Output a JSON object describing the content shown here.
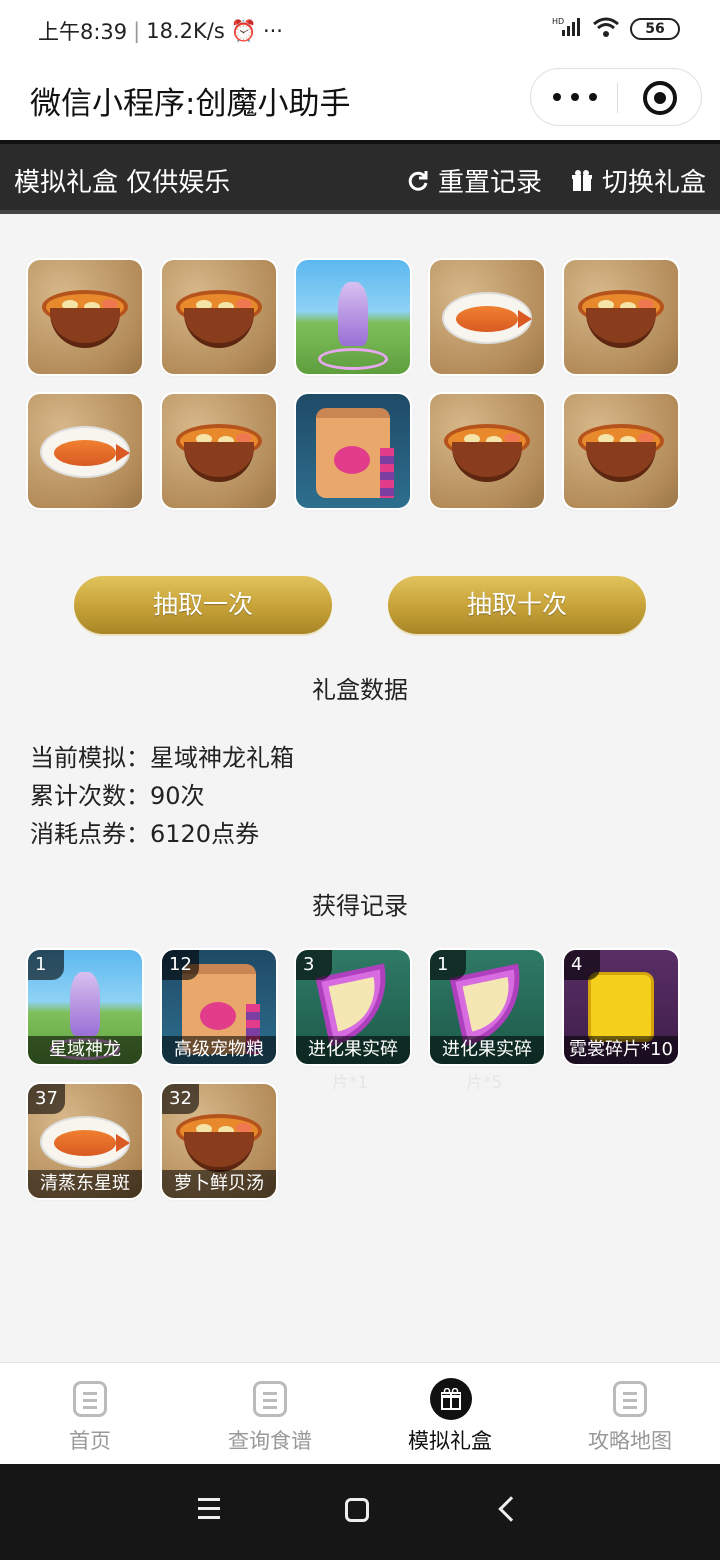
{
  "status": {
    "time": "上午8:39",
    "speed": "18.2K/s",
    "battery": "56",
    "network": "HD"
  },
  "titlebar": {
    "title": "微信小程序:创魔小助手"
  },
  "header": {
    "left": "模拟礼盒 仅供娱乐",
    "reset": "重置记录",
    "switch": "切换礼盒"
  },
  "grid": [
    {
      "type": "soup"
    },
    {
      "type": "soup"
    },
    {
      "type": "dragon"
    },
    {
      "type": "fish"
    },
    {
      "type": "soup"
    },
    {
      "type": "fish"
    },
    {
      "type": "soup"
    },
    {
      "type": "bag"
    },
    {
      "type": "soup"
    },
    {
      "type": "soup"
    }
  ],
  "buttons": {
    "draw_one": "抽取一次",
    "draw_ten": "抽取十次"
  },
  "stats": {
    "title": "礼盒数据",
    "current_label": "当前模拟：",
    "current_value": "星域神龙礼箱",
    "count_label": "累计次数：",
    "count_value": "90次",
    "cost_label": "消耗点券：",
    "cost_value": "6120点券"
  },
  "records": {
    "title": "获得记录",
    "items": [
      {
        "count": "1",
        "name": "星域神龙",
        "type": "dragon"
      },
      {
        "count": "12",
        "name": "高级宠物粮",
        "type": "bag"
      },
      {
        "count": "3",
        "name": "进化果实碎",
        "overflow": "片*1",
        "type": "fruit"
      },
      {
        "count": "1",
        "name": "进化果实碎",
        "overflow": "片*5",
        "type": "fruit"
      },
      {
        "count": "4",
        "name": "霓裳碎片*10",
        "type": "shirt"
      },
      {
        "count": "37",
        "name": "清蒸东星斑",
        "type": "fish"
      },
      {
        "count": "32",
        "name": "萝卜鲜贝汤",
        "type": "soup"
      }
    ]
  },
  "tabs": [
    {
      "label": "首页",
      "active": false
    },
    {
      "label": "查询食谱",
      "active": false
    },
    {
      "label": "模拟礼盒",
      "active": true
    },
    {
      "label": "攻略地图",
      "active": false
    }
  ]
}
